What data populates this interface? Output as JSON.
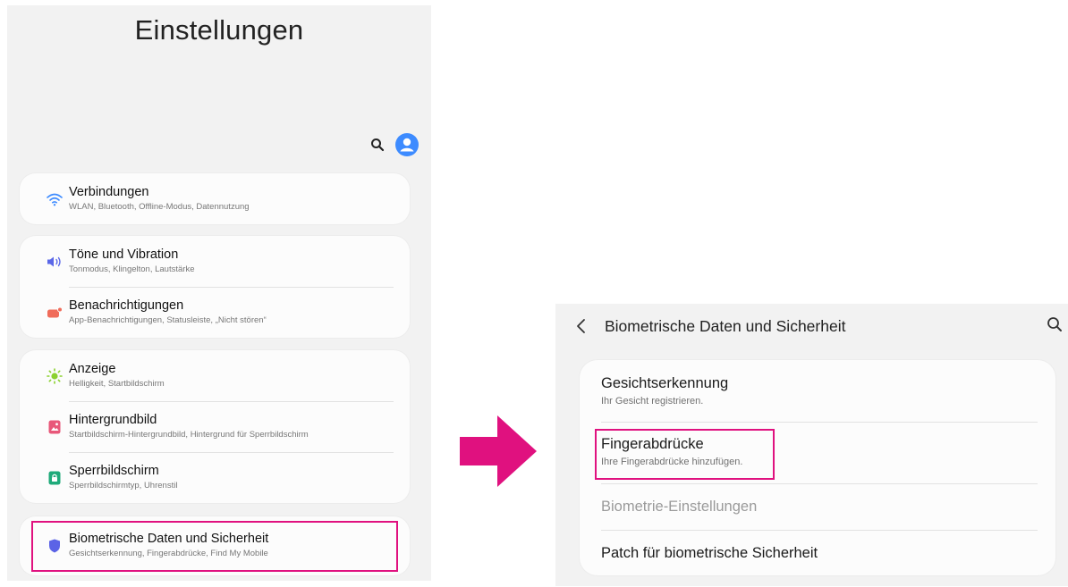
{
  "settings": {
    "title": "Einstellungen",
    "cards": [
      [
        {
          "icon": "wifi-icon",
          "color": "#3d8bff",
          "title": "Verbindungen",
          "subtitle": "WLAN, Bluetooth, Offline-Modus, Datennutzung"
        }
      ],
      [
        {
          "icon": "speaker-icon",
          "color": "#5a67e8",
          "title": "Töne und Vibration",
          "subtitle": "Tonmodus, Klingelton, Lautstärke"
        },
        {
          "icon": "notification-icon",
          "color": "#f06c5a",
          "title": "Benachrichtigungen",
          "subtitle": "App-Benachrichtigungen, Statusleiste, „Nicht stören“"
        }
      ],
      [
        {
          "icon": "brightness-icon",
          "color": "#8bd12f",
          "title": "Anzeige",
          "subtitle": "Helligkeit, Startbildschirm"
        },
        {
          "icon": "wallpaper-icon",
          "color": "#e8587a",
          "title": "Hintergrundbild",
          "subtitle": "Startbildschirm-Hintergrundbild, Hintergrund für Sperrbildschirm"
        },
        {
          "icon": "lock-icon",
          "color": "#1faa7a",
          "title": "Sperrbildschirm",
          "subtitle": "Sperrbildschirmtyp, Uhrenstil"
        }
      ],
      [
        {
          "icon": "shield-icon",
          "color": "#5b63e6",
          "title": "Biometrische Daten und Sicherheit",
          "subtitle": "Gesichtserkennung, Fingerabdrücke, Find My Mobile"
        }
      ]
    ]
  },
  "biometrics": {
    "title": "Biometrische Daten und Sicherheit",
    "items": [
      {
        "title": "Gesichtserkennung",
        "subtitle": "Ihr Gesicht registrieren."
      },
      {
        "title": "Fingerabdrücke",
        "subtitle": "Ihre Fingerabdrücke hinzufügen."
      },
      {
        "title": "Biometrie-Einstellungen"
      },
      {
        "title": "Patch für biometrische Sicherheit"
      }
    ]
  },
  "colors": {
    "highlight": "#e0117f",
    "accent": "#3d8bff"
  }
}
